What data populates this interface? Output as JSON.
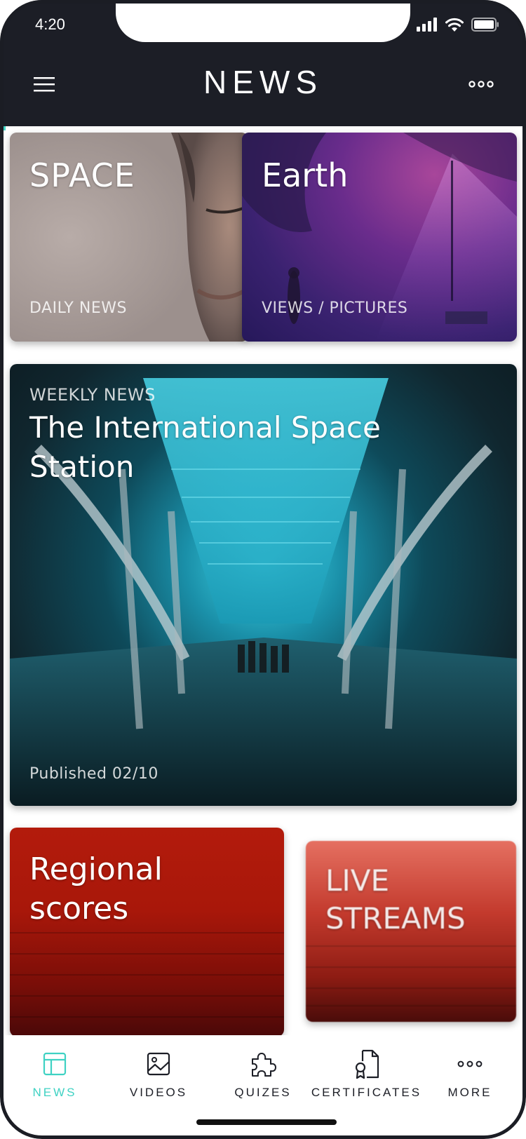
{
  "status_bar": {
    "time": "4:20"
  },
  "header": {
    "title": "NEWS"
  },
  "cards": {
    "space": {
      "title": "SPACE",
      "subtitle": "DAILY NEWS"
    },
    "earth": {
      "title": "Earth",
      "subtitle": "VIEWS / PICTURES"
    },
    "iss": {
      "kicker": "WEEKLY NEWS",
      "title_line1": "The International Space",
      "title_line2": "Station",
      "published": "Published 02/10"
    },
    "regional": {
      "title_line1": "Regional",
      "title_line2": "scores"
    },
    "live": {
      "title_line1": "LIVE",
      "title_line2": "STREAMS"
    }
  },
  "tabs": [
    {
      "label": "NEWS",
      "icon": "layout-icon",
      "active": true
    },
    {
      "label": "VIDEOS",
      "icon": "image-icon",
      "active": false
    },
    {
      "label": "QUIZES",
      "icon": "puzzle-icon",
      "active": false
    },
    {
      "label": "CERTIFICATES",
      "icon": "certificate-icon",
      "active": false
    },
    {
      "label": "MORE",
      "icon": "more-dots-icon",
      "active": false
    }
  ],
  "colors": {
    "header_bg": "#1c1e26",
    "accent": "#3fd2c3",
    "text_dark": "#1c1e26"
  }
}
